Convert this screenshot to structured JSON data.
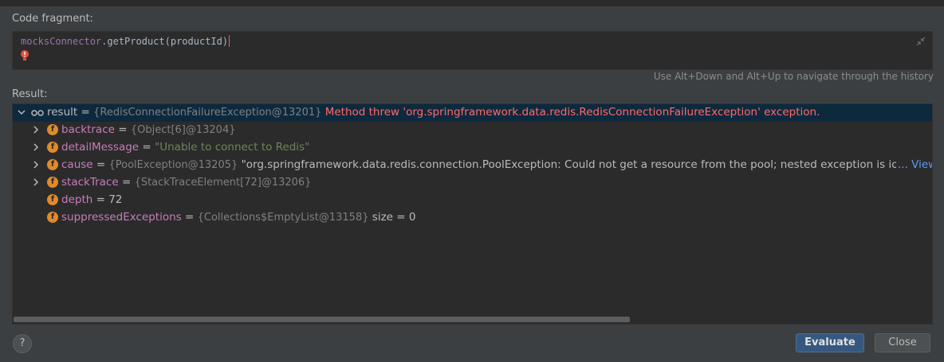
{
  "labels": {
    "code_fragment": "Code fragment:",
    "result": "Result:",
    "hint": "Use Alt+Down and Alt+Up to navigate through the history"
  },
  "editor": {
    "code_object": "mocksConnector",
    "code_rest": ".getProduct(productId)"
  },
  "tree": {
    "root": {
      "name": "result",
      "eq": " = ",
      "ref": "{RedisConnectionFailureException@13201}",
      "message": " Method threw 'org.springframework.data.redis.RedisConnectionFailureException' exception."
    },
    "children": [
      {
        "name": "backtrace",
        "eq": " = ",
        "value": "{Object[6]@13204}",
        "expandable": true
      },
      {
        "name": "detailMessage",
        "eq": " = ",
        "value": "\"Unable to connect to Redis\"",
        "expandable": true
      },
      {
        "name": "cause",
        "eq": " = ",
        "value": "{PoolException@13205}",
        "extra": " \"org.springframework.data.redis.connection.PoolException: Could not get a resource from the pool; nested exception is io.l",
        "link": "... View",
        "expandable": true
      },
      {
        "name": "stackTrace",
        "eq": " = ",
        "value": "{StackTraceElement[72]@13206}",
        "expandable": true
      },
      {
        "name": "depth",
        "eq": " = ",
        "value": "72",
        "expandable": false
      },
      {
        "name": "suppressedExceptions",
        "eq": " = ",
        "value": "{Collections$EmptyList@13158}",
        "extra": "  size = 0",
        "expandable": false
      }
    ],
    "field_icon_letter": "f"
  },
  "buttons": {
    "help": "?",
    "evaluate": "Evaluate",
    "close": "Close"
  },
  "colors": {
    "background": "#3c3f41",
    "editor_bg": "#2b2b2b",
    "selection": "#0d293e",
    "error": "#ff6b68",
    "field_name": "#c77dbb",
    "string": "#6a8759",
    "accent_button": "#365880"
  },
  "icons": [
    "lightbulb-error-icon",
    "collapse-icon",
    "watch-glasses-icon",
    "chevron-down-icon",
    "chevron-right-icon",
    "field-icon"
  ]
}
